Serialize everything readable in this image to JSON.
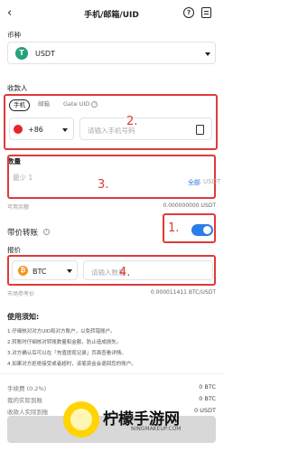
{
  "header": {
    "back_icon": "arrow-left-icon",
    "title": "手机/邮箱/UID",
    "help_glyph": "?",
    "history_icon": "order-list-icon"
  },
  "currency": {
    "label": "币种",
    "selected": "USDT",
    "coin_glyph": "T",
    "coin_color": "#26a17b"
  },
  "recipient": {
    "label": "收款人",
    "tabs": [
      {
        "label": "手机",
        "active": true
      },
      {
        "label": "邮箱",
        "active": false
      },
      {
        "label": "Gate UID",
        "active": false
      }
    ],
    "country_code": "+86",
    "phone_placeholder": "请输入手机号码"
  },
  "amount": {
    "label": "数量",
    "placeholder": "最少 1",
    "all_label": "全部",
    "unit": "USDT",
    "available_label": "可用余额",
    "available_value": "0.000000000 USDT"
  },
  "priced_transfer": {
    "label": "带价转账",
    "enabled": true,
    "price_label": "报价",
    "coin": "BTC",
    "coin_glyph": "₿",
    "coin_color": "#f7931a",
    "price_placeholder": "请输入数量",
    "rate_label": "市场参考价",
    "rate_value": "0.000011411 BTC/USDT"
  },
  "annotations": [
    "1.",
    "2.",
    "3.",
    "4."
  ],
  "notes": {
    "title": "使用须知:",
    "items": [
      "1.仔细核对对方UID和对方账户，以免转错账户。",
      "2.转账时仔细核对转账数量和金额，防止造成损失。",
      "3.对方确认后可以在「充值提现记录」页面查看详情。",
      "4.如果对方拒绝接受或者超时，该笔资金会退回您的账户。"
    ]
  },
  "summary": {
    "fee_label": "手续费 (0.2%)",
    "fee_value": "0 BTC",
    "received_label": "我的实际到账",
    "received_value": "0 BTC",
    "payee_label": "收款人实际到账",
    "payee_value": "0 USDT"
  },
  "watermark": {
    "brand": "柠檬手游网",
    "url": "NINGMAKEUP.COM"
  },
  "colors": {
    "accent": "#2b7de9",
    "annotation": "#e03a3a"
  }
}
